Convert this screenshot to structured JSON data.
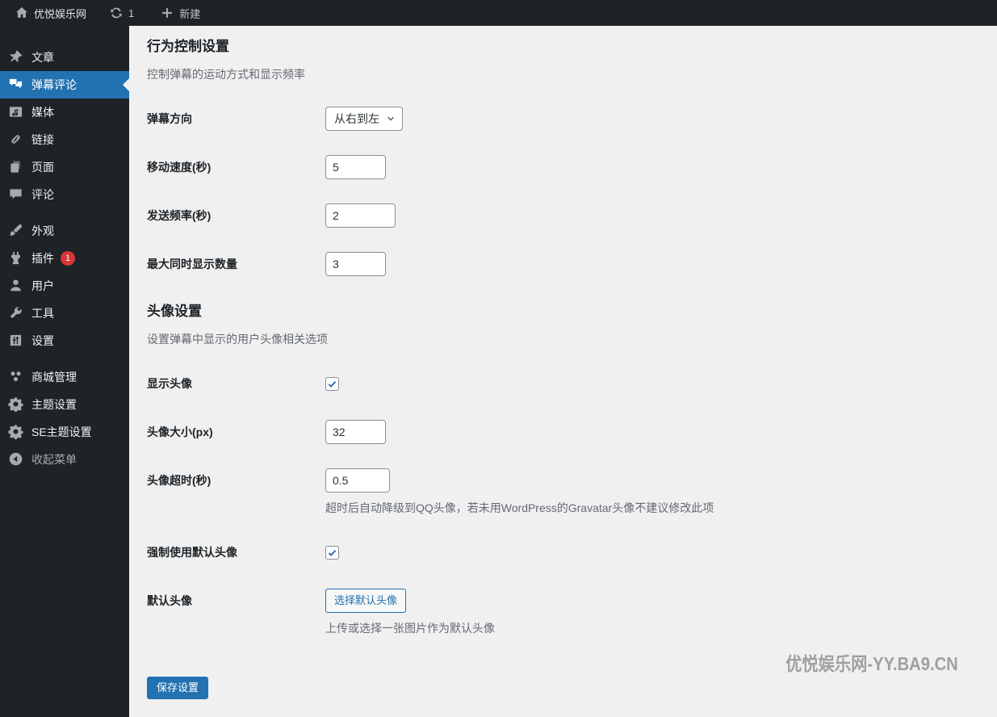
{
  "admin_bar": {
    "site_name": "优悦娱乐网",
    "update_count": "1",
    "new_label": "新建"
  },
  "sidebar": {
    "items": [
      {
        "label": "文章",
        "icon": "pin-icon"
      },
      {
        "label": "弹幕评论",
        "icon": "comments-icon",
        "active": true
      },
      {
        "label": "媒体",
        "icon": "media-icon"
      },
      {
        "label": "链接",
        "icon": "link-icon"
      },
      {
        "label": "页面",
        "icon": "pages-icon"
      },
      {
        "label": "评论",
        "icon": "comment-icon"
      },
      {
        "label": "外观",
        "icon": "brush-icon"
      },
      {
        "label": "插件",
        "icon": "plugin-icon",
        "badge": "1"
      },
      {
        "label": "用户",
        "icon": "user-icon"
      },
      {
        "label": "工具",
        "icon": "wrench-icon"
      },
      {
        "label": "设置",
        "icon": "settings-icon"
      },
      {
        "label": "商城管理",
        "icon": "store-icon"
      },
      {
        "label": "主题设置",
        "icon": "gear-icon"
      },
      {
        "label": "SE主题设置",
        "icon": "gear-icon"
      },
      {
        "label": "收起菜单",
        "icon": "collapse-icon"
      }
    ]
  },
  "content": {
    "behavior_section": {
      "title": "行为控制设置",
      "description": "控制弹幕的运动方式和显示频率"
    },
    "avatar_section": {
      "title": "头像设置",
      "description": "设置弹幕中显示的用户头像相关选项"
    },
    "fields": {
      "direction": {
        "label": "弹幕方向",
        "value": "从右到左"
      },
      "speed": {
        "label": "移动速度(秒)",
        "value": "5"
      },
      "frequency": {
        "label": "发送频率(秒)",
        "value": "2"
      },
      "max_count": {
        "label": "最大同时显示数量",
        "value": "3"
      },
      "show_avatar": {
        "label": "显示头像",
        "checked": true
      },
      "avatar_size": {
        "label": "头像大小(px)",
        "value": "32"
      },
      "avatar_timeout": {
        "label": "头像超时(秒)",
        "value": "0.5",
        "note": "超时后自动降级到QQ头像，若未用WordPress的Gravatar头像不建议修改此项"
      },
      "force_default_avatar": {
        "label": "强制使用默认头像",
        "checked": true
      },
      "default_avatar": {
        "label": "默认头像",
        "button_label": "选择默认头像",
        "note": "上传或选择一张图片作为默认头像"
      }
    },
    "save_button_label": "保存设置",
    "watermark": "优悦娱乐网-YY.BA9.CN"
  },
  "colors": {
    "accent": "#2271b1",
    "badge": "#d63638",
    "sidebar_bg": "#1d2327",
    "content_bg": "#f0f0f1",
    "check": "#2f6fb7"
  }
}
